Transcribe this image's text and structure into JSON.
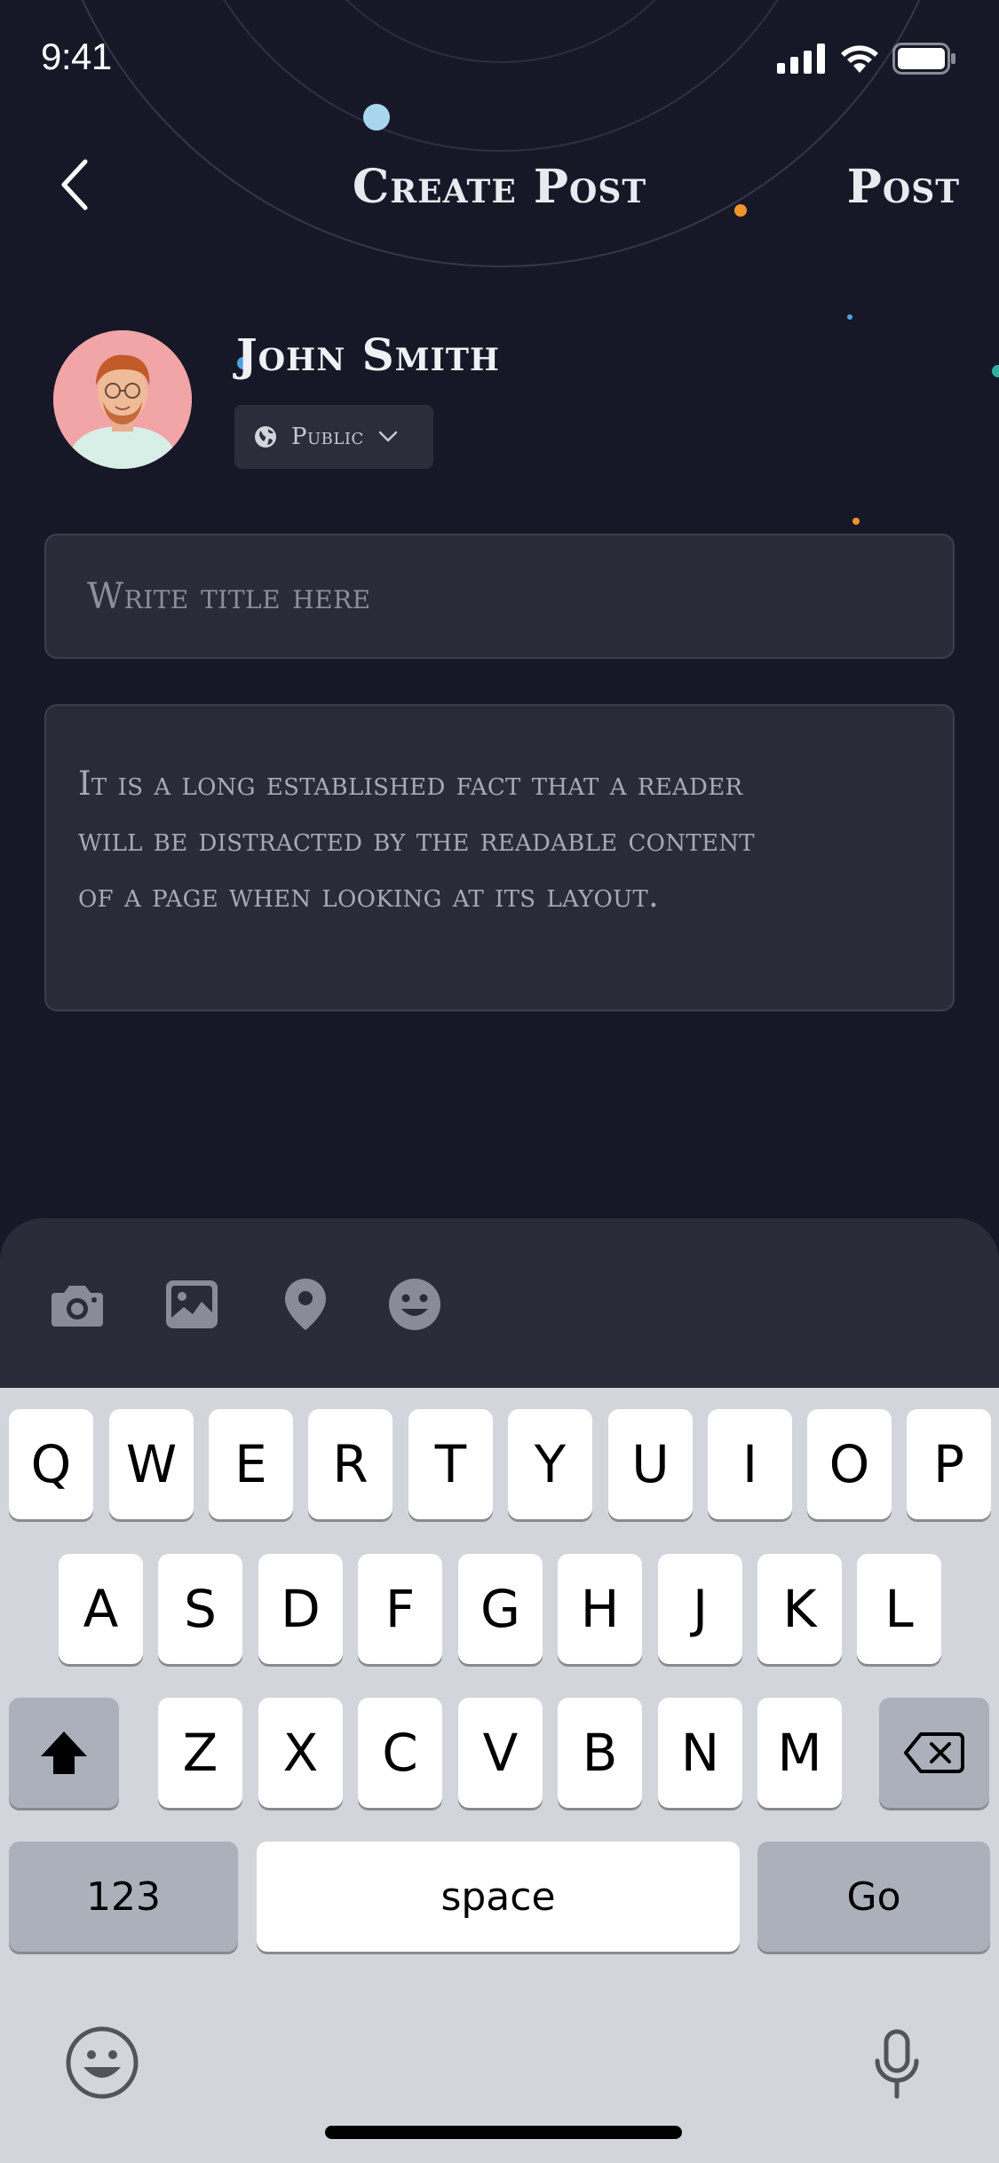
{
  "status_bar": {
    "time": "9:41"
  },
  "header": {
    "title": "Create Post",
    "post_label": "Post"
  },
  "profile": {
    "name": "John Smith",
    "privacy": "Public"
  },
  "title_field": {
    "placeholder": "Write title here"
  },
  "body_field": {
    "text": "It is a long established fact that a reader will be distracted by the readable content of a page when looking at its layout."
  },
  "toolbar": {
    "icons": [
      "camera-icon",
      "image-icon",
      "location-icon",
      "emoji-icon"
    ]
  },
  "keyboard": {
    "row1": [
      "Q",
      "W",
      "E",
      "R",
      "T",
      "Y",
      "U",
      "I",
      "O",
      "P"
    ],
    "row2": [
      "A",
      "S",
      "D",
      "F",
      "G",
      "H",
      "J",
      "K",
      "L"
    ],
    "row3": [
      "Z",
      "X",
      "C",
      "V",
      "B",
      "N",
      "M"
    ],
    "numbers_label": "123",
    "space_label": "space",
    "go_label": "Go"
  },
  "colors": {
    "background": "#171827",
    "panel": "#2a2b38",
    "accent_blue": "#a9d6ef",
    "accent_orange": "#f2942c"
  }
}
